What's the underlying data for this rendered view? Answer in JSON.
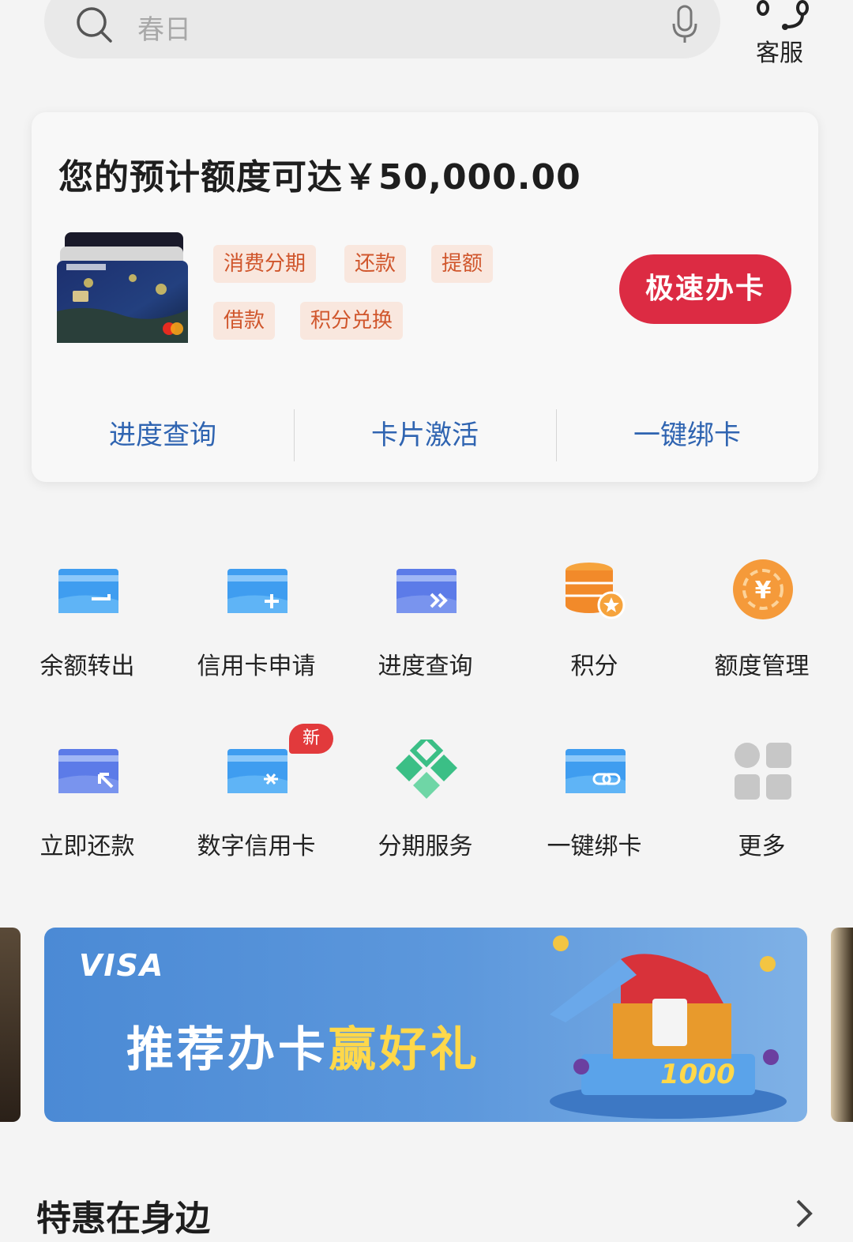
{
  "header": {
    "search_placeholder": "春日",
    "service_label": "客服"
  },
  "card": {
    "limit_text": "您的预计额度可达￥50,000.00",
    "tags": [
      "消费分期",
      "还款",
      "提额",
      "借款",
      "积分兑换"
    ],
    "apply_label": "极速办卡",
    "actions": [
      "进度查询",
      "卡片激活",
      "一键绑卡"
    ]
  },
  "grid": {
    "items": [
      {
        "label": "余额转出",
        "icon": "balance-transfer-icon"
      },
      {
        "label": "信用卡申请",
        "icon": "card-apply-icon"
      },
      {
        "label": "进度查询",
        "icon": "progress-query-icon"
      },
      {
        "label": "积分",
        "icon": "points-icon"
      },
      {
        "label": "额度管理",
        "icon": "limit-manage-icon"
      },
      {
        "label": "立即还款",
        "icon": "repay-icon"
      },
      {
        "label": "数字信用卡",
        "icon": "digital-card-icon"
      },
      {
        "label": "分期服务",
        "icon": "installment-icon"
      },
      {
        "label": "一键绑卡",
        "icon": "bind-card-icon"
      },
      {
        "label": "更多",
        "icon": "more-grid-icon"
      }
    ],
    "new_badge": "新"
  },
  "banner": {
    "brand": "VISA",
    "headline_a": "推荐办卡",
    "headline_b": "赢好礼",
    "amount": "1000"
  },
  "section": {
    "title": "特惠在身边"
  },
  "colors": {
    "brand_red": "#dc2b43",
    "link_blue": "#2f64b1",
    "tag_text": "#d0562c",
    "tag_bg": "#f9e7de"
  }
}
